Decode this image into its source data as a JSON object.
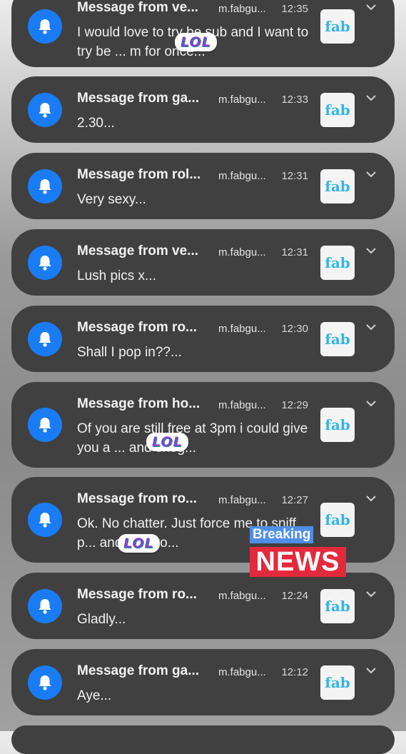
{
  "notifications": [
    {
      "title": "Message from ve...",
      "app": "m.fabgu...",
      "time": "12:35",
      "body": "I would love to try be sub and I want to try be ... m for once...",
      "thumb": "fab"
    },
    {
      "title": "Message from ga...",
      "app": "m.fabgu...",
      "time": "12:33",
      "body": "2.30...",
      "thumb": "fab"
    },
    {
      "title": "Message from rol...",
      "app": "m.fabgu...",
      "time": "12:31",
      "body": "Very sexy...",
      "thumb": "fab"
    },
    {
      "title": "Message from ve...",
      "app": "m.fabgu...",
      "time": "12:31",
      "body": "Lush pics x...",
      "thumb": "fab"
    },
    {
      "title": "Message from ro...",
      "app": "m.fabgu...",
      "time": "12:30",
      "body": "Shall I pop in??...",
      "thumb": "fab"
    },
    {
      "title": "Message from ho...",
      "app": "m.fabgu...",
      "time": "12:29",
      "body": "Of you are still free at 3pm i could give you a ... and snog...",
      "thumb": "fab"
    },
    {
      "title": "Message from ro...",
      "app": "m.fabgu...",
      "time": "12:27",
      "body": "Ok. No chatter. Just force me to sniff p... and ram yo...",
      "thumb": "fab"
    },
    {
      "title": "Message from ro...",
      "app": "m.fabgu...",
      "time": "12:24",
      "body": "Gladly...",
      "thumb": "fab"
    },
    {
      "title": "Message from ga...",
      "app": "m.fabgu...",
      "time": "12:12",
      "body": "Aye...",
      "thumb": "fab"
    }
  ],
  "stickers": {
    "lol_1": "LOL",
    "lol_2": "LOL",
    "lol_3": "LOL",
    "breaking": "Breaking",
    "news": "NEWS"
  },
  "colors": {
    "card": "#404040",
    "bell": "#1a7cf5",
    "thumb_text": "#35b5e5",
    "news_red": "#e32a3d",
    "breaking_blue": "#4e8fe6"
  }
}
